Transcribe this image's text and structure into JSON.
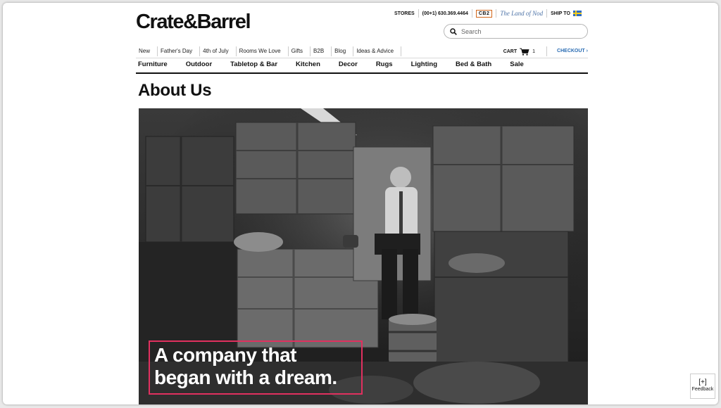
{
  "brand": {
    "logo": "Crate&Barrel"
  },
  "utility": {
    "stores": "STORES",
    "phone": "(00+1) 630.369.4464",
    "cb2": "CB2",
    "nod": "The Land of Nod",
    "ship_to": "SHIP TO"
  },
  "search": {
    "placeholder": "Search"
  },
  "subnav": {
    "items": [
      "New",
      "Father's Day",
      "4th of July",
      "Rooms We Love",
      "Gifts",
      "B2B",
      "Blog",
      "Ideas & Advice"
    ],
    "cart_label": "CART",
    "cart_count": "1",
    "checkout": "CHECKOUT ›"
  },
  "mainnav": {
    "items": [
      "Furniture",
      "Outdoor",
      "Tabletop & Bar",
      "Kitchen",
      "Decor",
      "Rugs",
      "Lighting",
      "Bed & Bath",
      "Sale"
    ]
  },
  "page": {
    "title": "About Us",
    "hero_caption_line1": "A company that",
    "hero_caption_line2": "began with a dream."
  },
  "feedback": {
    "plus": "[+]",
    "label": "Feedback"
  },
  "colors": {
    "accent_pink": "#e0305f",
    "checkout_blue": "#2a6cb3",
    "cb2_orange": "#d2661a"
  }
}
